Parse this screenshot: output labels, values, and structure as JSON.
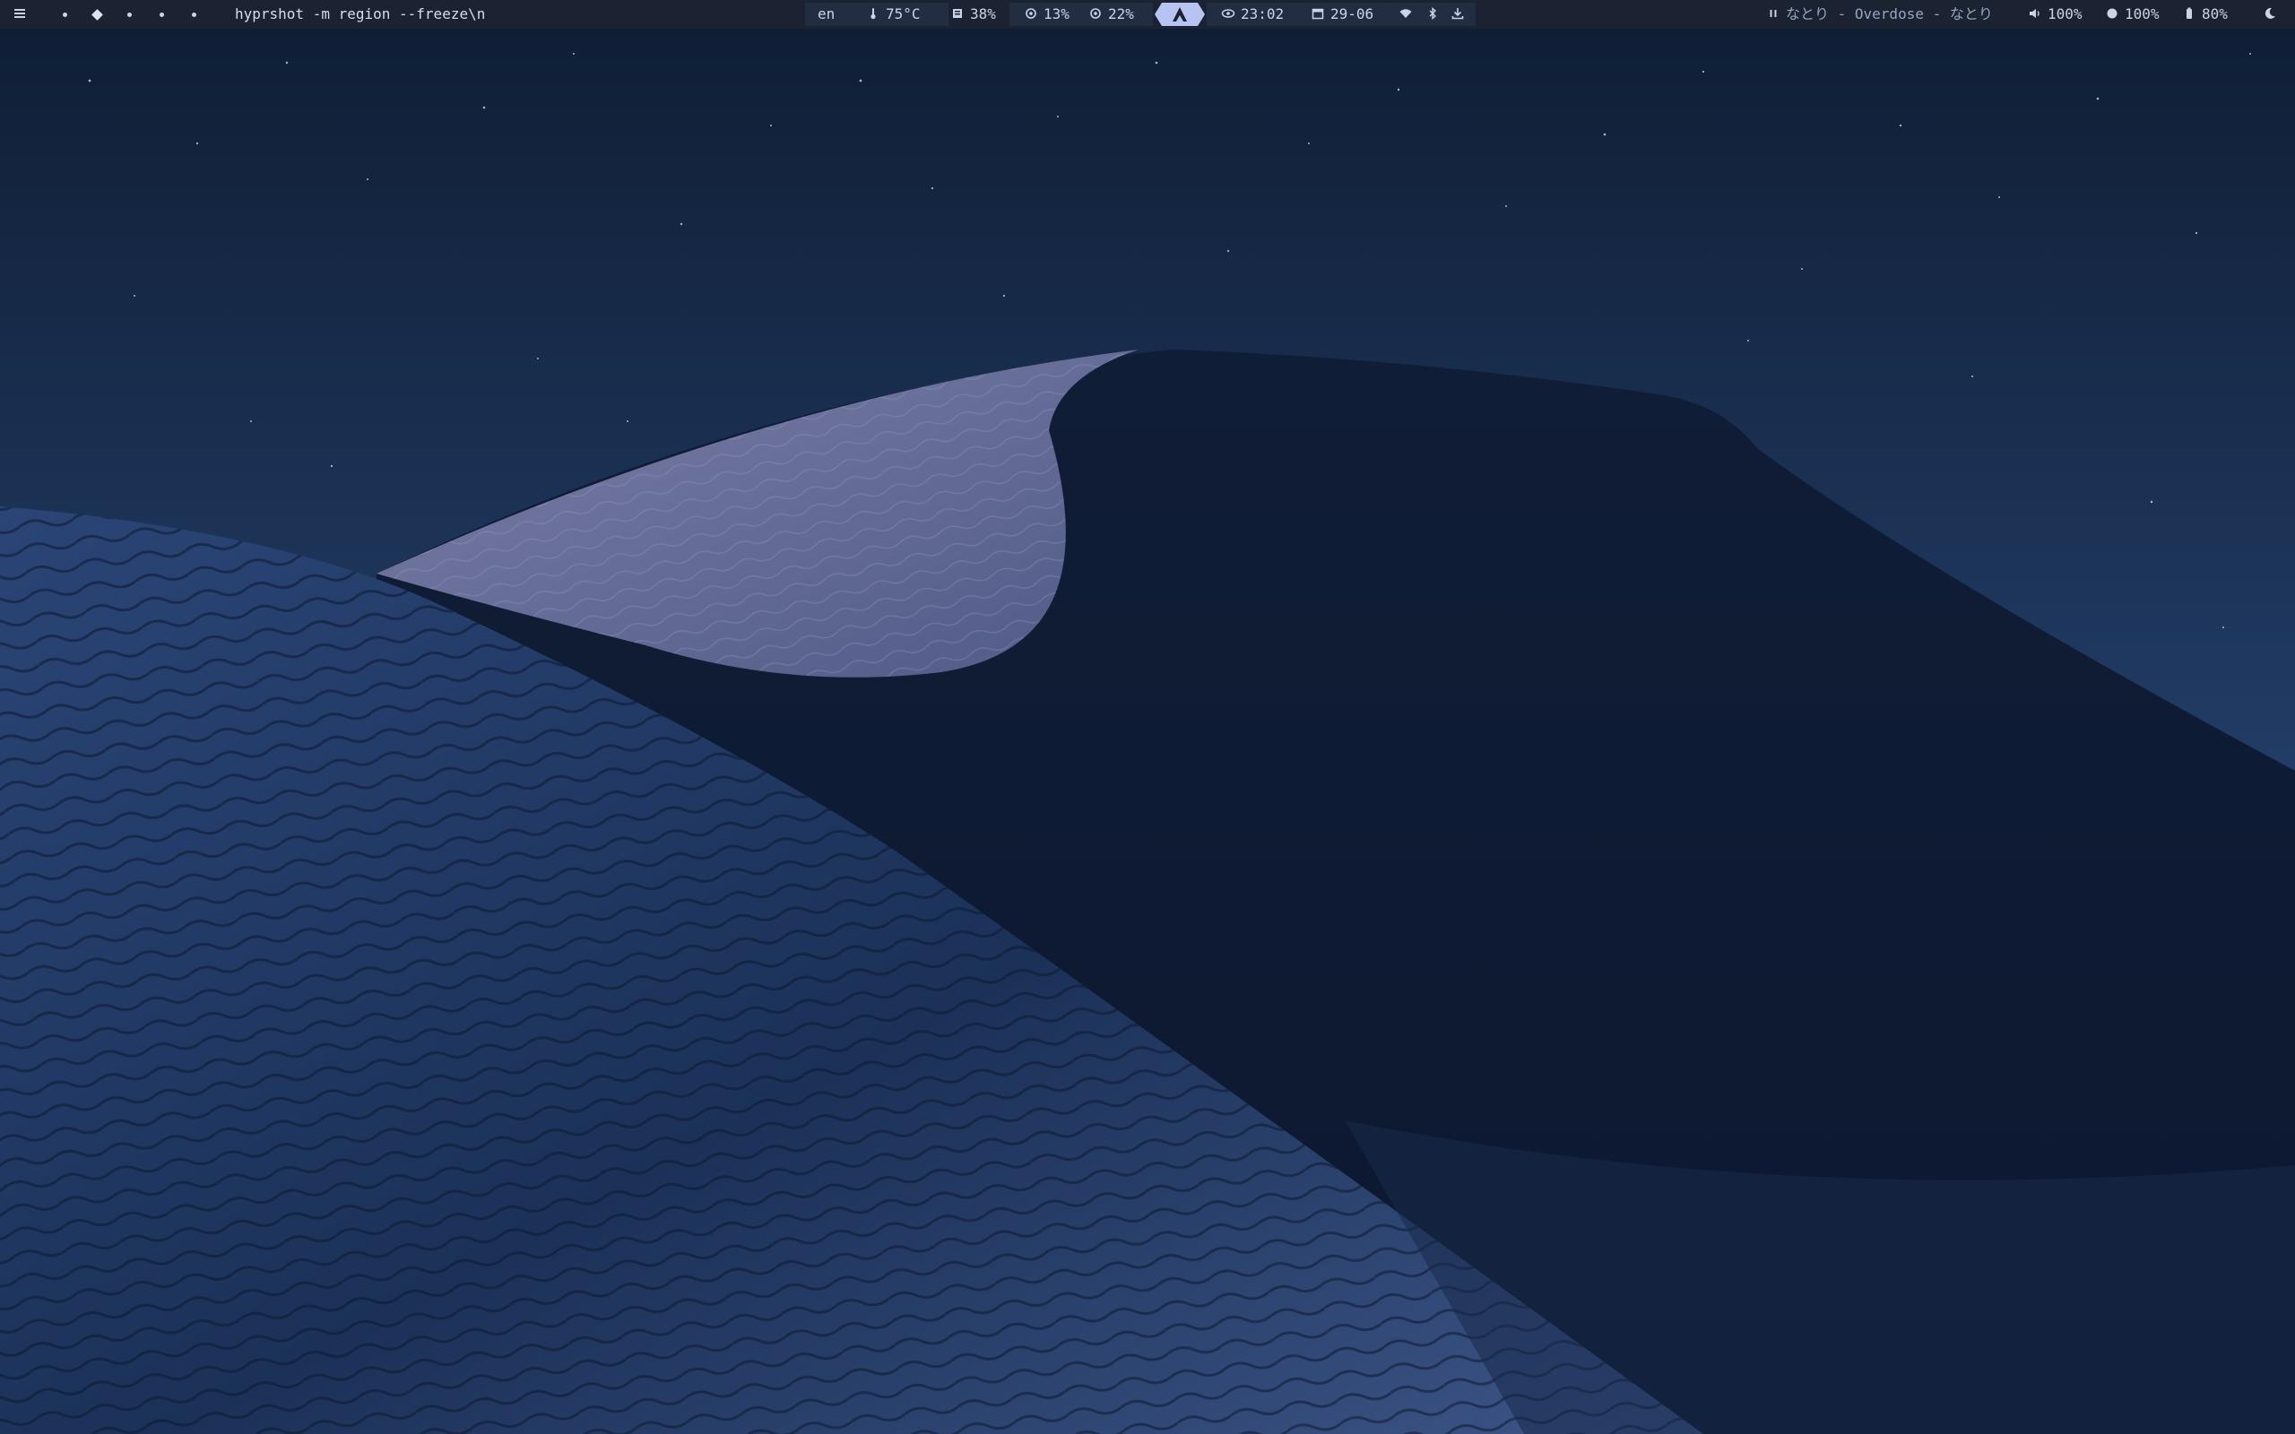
{
  "topbar": {
    "menu_icon": "hamburger-menu-icon",
    "workspaces": [
      {
        "id": 1,
        "icon": "dot-icon"
      },
      {
        "id": 2,
        "icon": "diamond-icon",
        "active": true
      },
      {
        "id": 3,
        "icon": "dot-icon"
      },
      {
        "id": 4,
        "icon": "dot-icon"
      },
      {
        "id": 5,
        "icon": "dot-icon"
      }
    ],
    "window_title": "hyprshot -m region --freeze\\n",
    "keyboard_layout": "en",
    "temperature": "75°C",
    "memory": "38%",
    "cpu": "13%",
    "disk": "22%",
    "arch_logo": "arch-linux-logo-icon",
    "clock": "23:02",
    "date": "29-06",
    "wifi_icon": "wifi-icon",
    "bluetooth_icon": "bluetooth-icon",
    "updates_icon": "download-icon",
    "media": {
      "state_icon": "pause-icon",
      "text": "なとり - Overdose - なとり"
    },
    "volume": "100%",
    "brightness": "100%",
    "battery": "80%",
    "theme_icon": "moon-icon"
  },
  "colors": {
    "bar_bg": "#1b2333",
    "bar_text": "#cdd3e6",
    "pill_bg": "#232d42",
    "accent": "#b7c3f3",
    "sky_top": "#0f1d33",
    "sky_horizon": "#34528a",
    "dune_shadow": "#0e1b33",
    "dune_lit": "#6a6f99"
  }
}
